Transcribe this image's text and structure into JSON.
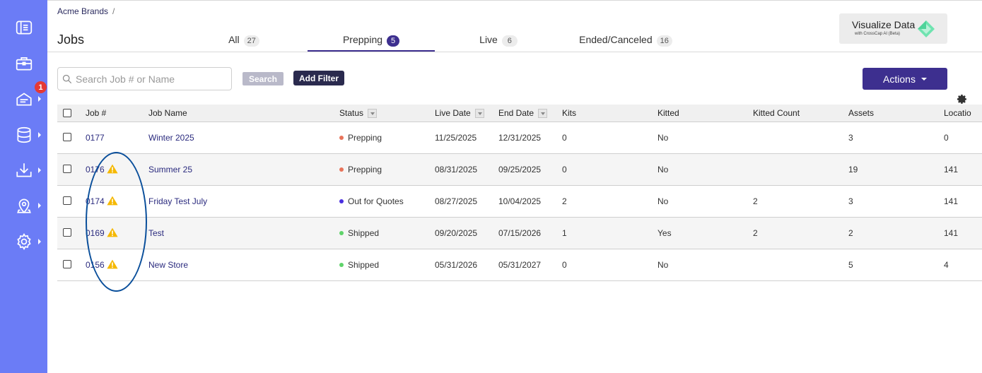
{
  "breadcrumb": {
    "root": "Acme Brands",
    "separator": "/"
  },
  "page_title": "Jobs",
  "tabs": [
    {
      "label": "All",
      "count": "27"
    },
    {
      "label": "Prepping",
      "count": "5"
    },
    {
      "label": "Live",
      "count": "6"
    },
    {
      "label": "Ended/Canceled",
      "count": "16"
    }
  ],
  "active_tab": "Prepping",
  "visualize": {
    "title": "Visualize Data",
    "subtitle": "with CrossCap AI (Beta)"
  },
  "search": {
    "placeholder": "Search Job # or Name",
    "value": ""
  },
  "buttons": {
    "search": "Search",
    "add_filter": "Add Filter",
    "actions": "Actions"
  },
  "sidebar": {
    "items": [
      {
        "icon": "sidebar-panel-icon"
      },
      {
        "icon": "briefcase-icon"
      },
      {
        "icon": "inbox-tray-icon",
        "badge": "1"
      },
      {
        "icon": "database-icon"
      },
      {
        "icon": "download-icon"
      },
      {
        "icon": "location-pin-icon"
      },
      {
        "icon": "gear-icon"
      }
    ]
  },
  "table": {
    "headers": {
      "job_no": "Job #",
      "job_name": "Job Name",
      "status": "Status",
      "live_date": "Live Date",
      "end_date": "End Date",
      "kits": "Kits",
      "kitted": "Kitted",
      "kitted_count": "Kitted Count",
      "assets": "Assets",
      "location": "Locatio"
    },
    "rows": [
      {
        "job_no": "0177",
        "job_name": "Winter 2025",
        "status": "Prepping",
        "status_color": "#e8735a",
        "live_date": "11/25/2025",
        "end_date": "12/31/2025",
        "kits": "0",
        "kitted": "No",
        "kitted_count": "",
        "assets": "3",
        "location": "0",
        "warning": false
      },
      {
        "job_no": "0176",
        "job_name": "Summer 25",
        "status": "Prepping",
        "status_color": "#e8735a",
        "live_date": "08/31/2025",
        "end_date": "09/25/2025",
        "kits": "0",
        "kitted": "No",
        "kitted_count": "",
        "assets": "19",
        "location": "141",
        "warning": true
      },
      {
        "job_no": "0174",
        "job_name": "Friday Test July",
        "status": "Out for Quotes",
        "status_color": "#4a2fe0",
        "live_date": "08/27/2025",
        "end_date": "10/04/2025",
        "kits": "2",
        "kitted": "No",
        "kitted_count": "2",
        "assets": "3",
        "location": "141",
        "warning": true
      },
      {
        "job_no": "0169",
        "job_name": "Test",
        "status": "Shipped",
        "status_color": "#5fd36a",
        "live_date": "09/20/2025",
        "end_date": "07/15/2026",
        "kits": "1",
        "kitted": "Yes",
        "kitted_count": "2",
        "assets": "2",
        "location": "141",
        "warning": true
      },
      {
        "job_no": "0156",
        "job_name": "New Store",
        "status": "Shipped",
        "status_color": "#5fd36a",
        "live_date": "05/31/2026",
        "end_date": "05/31/2027",
        "kits": "0",
        "kitted": "No",
        "kitted_count": "",
        "assets": "5",
        "location": "4",
        "warning": true
      }
    ]
  },
  "colors": {
    "sidebar": "#6b7cf6",
    "primary": "#3d2f8f",
    "warning": "#f5b800",
    "annotation": "#0a4f9b"
  }
}
